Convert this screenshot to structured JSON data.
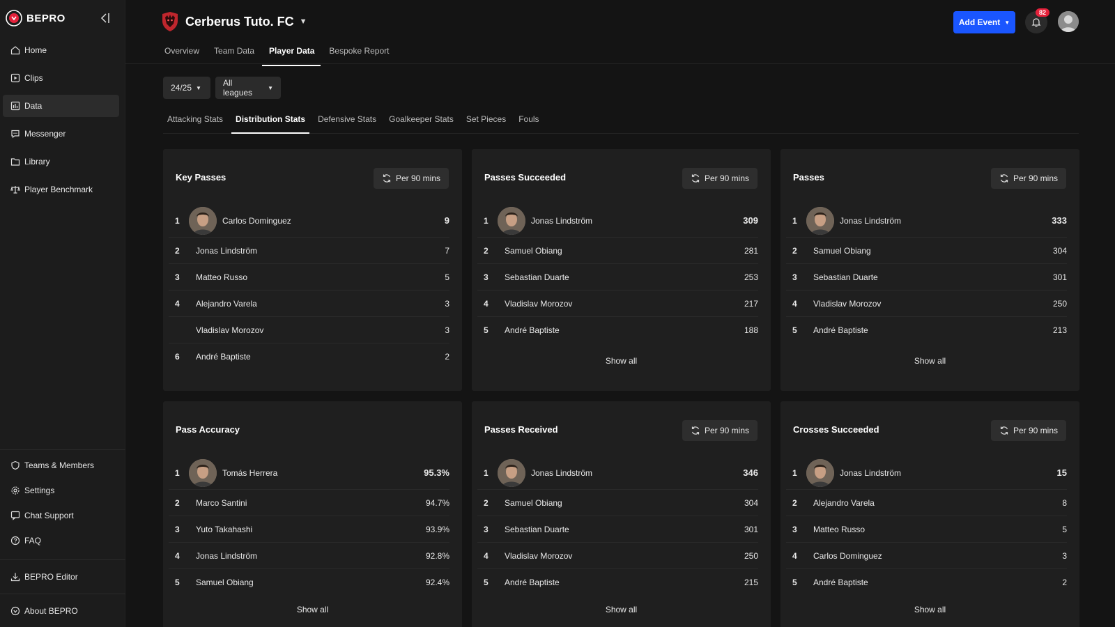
{
  "app": {
    "name": "BEPRO"
  },
  "sidebar": {
    "items": [
      {
        "label": "Home",
        "icon": "home-icon"
      },
      {
        "label": "Clips",
        "icon": "clips-icon"
      },
      {
        "label": "Data",
        "icon": "data-icon",
        "active": true
      },
      {
        "label": "Messenger",
        "icon": "messenger-icon"
      },
      {
        "label": "Library",
        "icon": "folder-icon"
      },
      {
        "label": "Player Benchmark",
        "icon": "benchmark-icon"
      }
    ],
    "bottom": [
      {
        "label": "Teams & Members",
        "icon": "shield-icon"
      },
      {
        "label": "Settings",
        "icon": "gear-icon"
      },
      {
        "label": "Chat Support",
        "icon": "chat-icon"
      },
      {
        "label": "FAQ",
        "icon": "question-icon"
      }
    ],
    "editor": {
      "label": "BEPRO Editor",
      "icon": "download-icon"
    },
    "about": {
      "label": "About BEPRO",
      "icon": "bepro-logo-icon"
    }
  },
  "header": {
    "team_name": "Cerberus Tuto. FC",
    "tabs": [
      "Overview",
      "Team Data",
      "Player Data",
      "Bespoke Report"
    ],
    "active_tab": "Player Data",
    "add_event_label": "Add Event",
    "notification_count": "82",
    "accent_color": "#1a56ff",
    "badge_color": "#e5213b"
  },
  "filters": {
    "season": "24/25",
    "league": "All leagues"
  },
  "sub_tabs": [
    "Attacking Stats",
    "Distribution Stats",
    "Defensive Stats",
    "Goalkeeper Stats",
    "Set Pieces",
    "Fouls"
  ],
  "active_sub_tab": "Distribution Stats",
  "per_label": "Per 90 mins",
  "show_all_label": "Show all",
  "cards": [
    {
      "title": "Key Passes",
      "has_toggle": true,
      "rows": [
        {
          "rank": "1",
          "name": "Carlos Dominguez",
          "value": "9"
        },
        {
          "rank": "2",
          "name": "Jonas Lindström",
          "value": "7"
        },
        {
          "rank": "3",
          "name": "Matteo Russo",
          "value": "5"
        },
        {
          "rank": "4",
          "name": "Alejandro Varela",
          "value": "3"
        },
        {
          "rank": "",
          "name": "Vladislav Morozov",
          "value": "3"
        },
        {
          "rank": "6",
          "name": "André Baptiste",
          "value": "2"
        }
      ]
    },
    {
      "title": "Passes Succeeded",
      "has_toggle": true,
      "rows": [
        {
          "rank": "1",
          "name": "Jonas Lindström",
          "value": "309"
        },
        {
          "rank": "2",
          "name": "Samuel Obiang",
          "value": "281"
        },
        {
          "rank": "3",
          "name": "Sebastian Duarte",
          "value": "253"
        },
        {
          "rank": "4",
          "name": "Vladislav Morozov",
          "value": "217"
        },
        {
          "rank": "5",
          "name": "André Baptiste",
          "value": "188"
        }
      ]
    },
    {
      "title": "Passes",
      "has_toggle": true,
      "rows": [
        {
          "rank": "1",
          "name": "Jonas Lindström",
          "value": "333"
        },
        {
          "rank": "2",
          "name": "Samuel Obiang",
          "value": "304"
        },
        {
          "rank": "3",
          "name": "Sebastian Duarte",
          "value": "301"
        },
        {
          "rank": "4",
          "name": "Vladislav Morozov",
          "value": "250"
        },
        {
          "rank": "5",
          "name": "André Baptiste",
          "value": "213"
        }
      ]
    },
    {
      "title": "Pass Accuracy",
      "has_toggle": false,
      "rows": [
        {
          "rank": "1",
          "name": "Tomás Herrera",
          "value": "95.3%"
        },
        {
          "rank": "2",
          "name": "Marco Santini",
          "value": "94.7%"
        },
        {
          "rank": "3",
          "name": "Yuto Takahashi",
          "value": "93.9%"
        },
        {
          "rank": "4",
          "name": "Jonas Lindström",
          "value": "92.8%"
        },
        {
          "rank": "5",
          "name": "Samuel Obiang",
          "value": "92.4%"
        }
      ]
    },
    {
      "title": "Passes Received",
      "has_toggle": true,
      "rows": [
        {
          "rank": "1",
          "name": "Jonas Lindström",
          "value": "346"
        },
        {
          "rank": "2",
          "name": "Samuel Obiang",
          "value": "304"
        },
        {
          "rank": "3",
          "name": "Sebastian Duarte",
          "value": "301"
        },
        {
          "rank": "4",
          "name": "Vladislav Morozov",
          "value": "250"
        },
        {
          "rank": "5",
          "name": "André Baptiste",
          "value": "215"
        }
      ]
    },
    {
      "title": "Crosses Succeeded",
      "has_toggle": true,
      "rows": [
        {
          "rank": "1",
          "name": "Jonas Lindström",
          "value": "15"
        },
        {
          "rank": "2",
          "name": "Alejandro Varela",
          "value": "8"
        },
        {
          "rank": "3",
          "name": "Matteo Russo",
          "value": "5"
        },
        {
          "rank": "4",
          "name": "Carlos Dominguez",
          "value": "3"
        },
        {
          "rank": "5",
          "name": "André Baptiste",
          "value": "2"
        }
      ]
    }
  ]
}
